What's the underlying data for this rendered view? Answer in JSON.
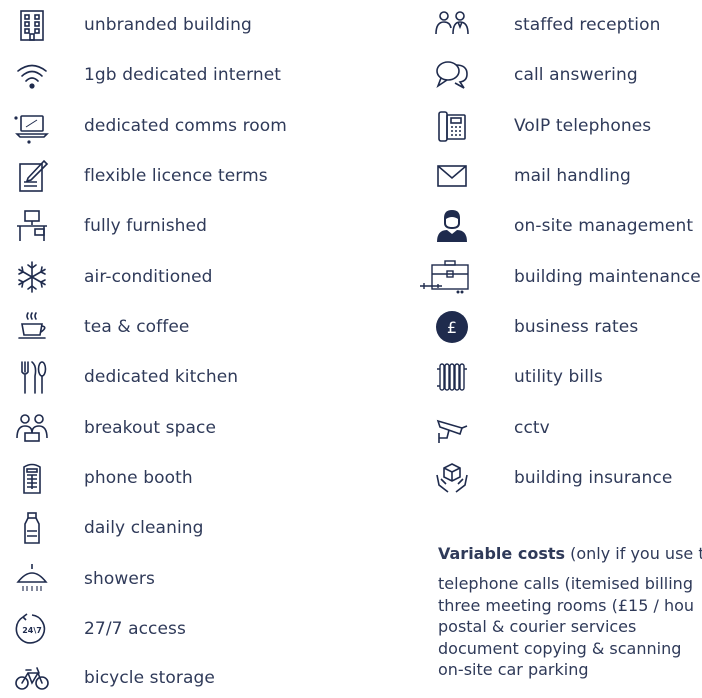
{
  "colors": {
    "text": "#2f3a59",
    "icon": "#1f2b4d",
    "background": "#ffffff"
  },
  "left_items": [
    {
      "label": "unbranded building",
      "icon": "building-icon"
    },
    {
      "label": "1gb dedicated internet",
      "icon": "wifi-icon"
    },
    {
      "label": "dedicated comms room",
      "icon": "laptop-icon"
    },
    {
      "label": "flexible licence terms",
      "icon": "contract-icon"
    },
    {
      "label": "fully furnished",
      "icon": "desk-icon"
    },
    {
      "label": "air-conditioned",
      "icon": "snowflake-icon"
    },
    {
      "label": "tea & coffee",
      "icon": "coffee-cup-icon"
    },
    {
      "label": "dedicated kitchen",
      "icon": "cutlery-icon"
    },
    {
      "label": "breakout space",
      "icon": "people-icon"
    },
    {
      "label": "phone booth",
      "icon": "phone-booth-icon"
    },
    {
      "label": "daily cleaning",
      "icon": "cleaning-bottle-icon"
    },
    {
      "label": "showers",
      "icon": "shower-icon"
    },
    {
      "label": "27/7 access",
      "icon": "24-7-icon"
    },
    {
      "label": "bicycle storage",
      "icon": "bicycle-icon"
    }
  ],
  "right_items": [
    {
      "label": "staffed reception",
      "icon": "reception-icon"
    },
    {
      "label": "call answering",
      "icon": "speech-bubbles-icon"
    },
    {
      "label": "VoIP telephones",
      "icon": "desk-phone-icon"
    },
    {
      "label": "mail handling",
      "icon": "envelope-icon"
    },
    {
      "label": "on-site management",
      "icon": "manager-icon"
    },
    {
      "label": "building maintenance",
      "icon": "toolbox-icon"
    },
    {
      "label": "business rates",
      "icon": "pound-icon"
    },
    {
      "label": "utility bills",
      "icon": "radiator-icon"
    },
    {
      "label": "cctv",
      "icon": "cctv-icon"
    },
    {
      "label": "building insurance",
      "icon": "insurance-icon"
    }
  ],
  "variable_costs": {
    "heading_bold": "Variable costs",
    "heading_rest": " (only if you use t",
    "lines": [
      "telephone calls (itemised billing",
      "three meeting rooms (£15 / hou",
      "postal & courier services",
      "document copying & scanning",
      "on-site car parking"
    ],
    "pound_glyph": "£",
    "clock_text": "24\\7"
  }
}
